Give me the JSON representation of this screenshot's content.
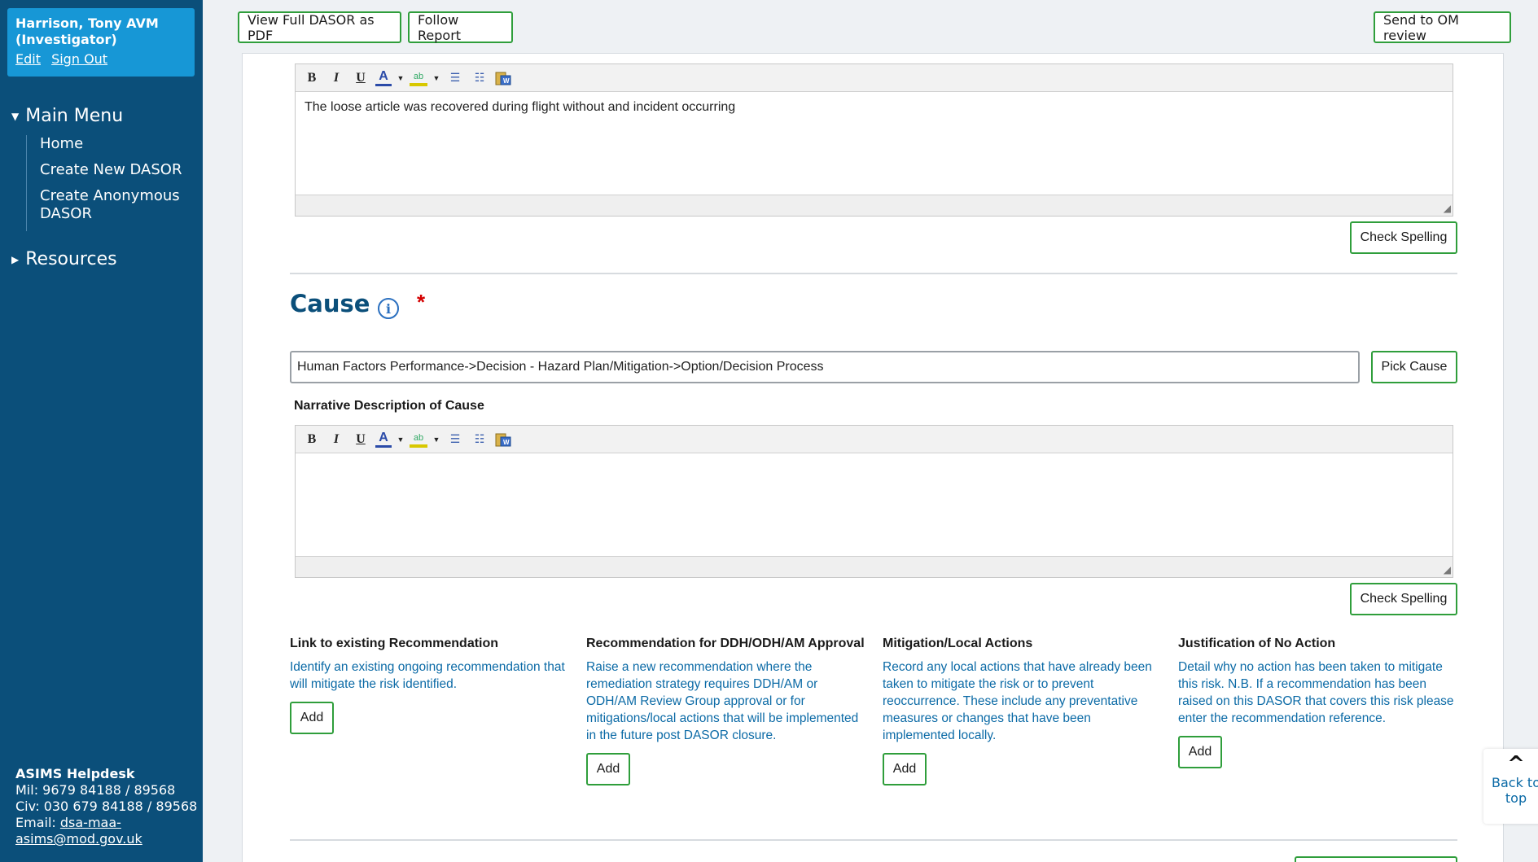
{
  "user": {
    "name": "Harrison, Tony AVM (Investigator)",
    "edit": "Edit",
    "signout": "Sign Out"
  },
  "menu": {
    "main_title": "Main Menu",
    "items": [
      "Home",
      "Create New DASOR",
      "Create Anonymous DASOR"
    ],
    "resources_title": "Resources"
  },
  "helpdesk": {
    "title": "ASIMS Helpdesk",
    "mil": "Mil: 9679 84188 / 89568",
    "civ": "Civ: 030 679 84188 / 89568",
    "email_label": "Email: ",
    "email": "dsa-maa-asims@mod.gov.uk"
  },
  "toolbar": {
    "view_pdf": "View Full DASOR as PDF",
    "follow": "Follow Report",
    "send_om": "Send to OM review"
  },
  "editor1": {
    "text": "The loose article was recovered during flight without and incident occurring"
  },
  "check_spelling": "Check Spelling",
  "cause": {
    "heading": "Cause",
    "info": "i",
    "required": "*",
    "value": "Human Factors Performance->Decision - Hazard Plan/Mitigation->Option/Decision Process",
    "pick_button": "Pick Cause",
    "narrative_label": "Narrative Description of Cause",
    "narrative_text": ""
  },
  "actions": [
    {
      "title": "Link to existing Recommendation",
      "desc": "Identify an existing ongoing recommendation that will mitigate the risk identified.",
      "button": "Add"
    },
    {
      "title": "Recommendation for DDH/ODH/AM Approval",
      "desc": "Raise a new recommendation where the remediation strategy requires DDH/AM or ODH/AM Review Group approval or for mitigations/local actions that will be implemented in the future post DASOR closure.",
      "button": "Add"
    },
    {
      "title": "Mitigation/Local Actions",
      "desc": "Record any local actions that have already been taken to mitigate the risk or to prevent reoccurrence. These include any preventative measures or changes that have been implemented locally.",
      "button": "Add"
    },
    {
      "title": "Justification of No Action",
      "desc": "Detail why no action has been taken to mitigate this risk. N.B. If a recommendation has been raised on this DASOR that covers this risk please enter the recommendation reference.",
      "button": "Add"
    }
  ],
  "back_to_top": "Back to top",
  "colors": {
    "sidebar": "#0b4f7a",
    "user_box": "#1797d6",
    "button_border": "#2f9e3b",
    "heading": "#0b4f7a",
    "desc_text": "#0b6aa6",
    "required": "#d40000"
  }
}
